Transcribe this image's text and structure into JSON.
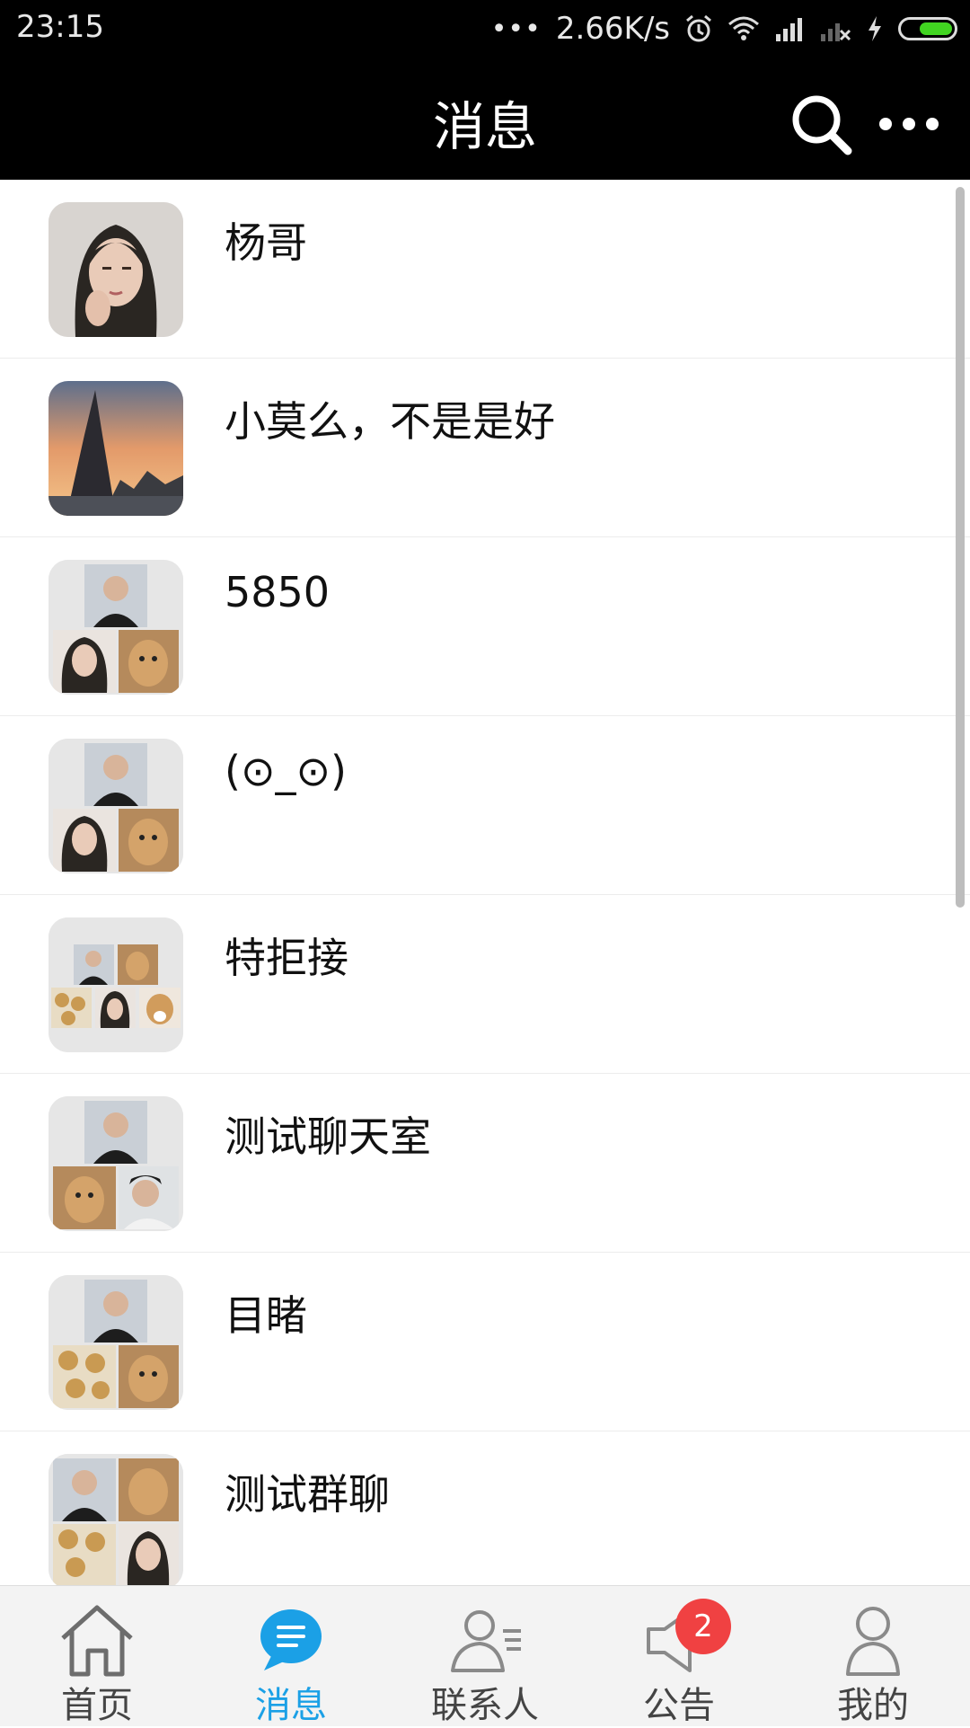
{
  "status_bar": {
    "time": "23:15",
    "net_speed": "2.66K/s",
    "dots": "•••",
    "icons": [
      "alarm-icon",
      "wifi-icon",
      "signal-icon",
      "signal-no-sim-icon",
      "charging-icon",
      "battery-icon"
    ]
  },
  "header": {
    "title": "消息",
    "icons": [
      "search-icon",
      "more-icon"
    ]
  },
  "conversations": [
    {
      "name": "杨哥"
    },
    {
      "name": "小莫么，不是是好"
    },
    {
      "name": "5850"
    },
    {
      "name": "(⊙_⊙)"
    },
    {
      "name": "特拒接"
    },
    {
      "name": "测试聊天室"
    },
    {
      "name": "目睹"
    },
    {
      "name": "测试群聊"
    }
  ],
  "tabs": [
    {
      "label": "首页",
      "icon": "home-icon"
    },
    {
      "label": "消息",
      "icon": "message-icon",
      "active": true
    },
    {
      "label": "联系人",
      "icon": "contacts-icon"
    },
    {
      "label": "公告",
      "icon": "announcement-icon",
      "badge": "2"
    },
    {
      "label": "我的",
      "icon": "profile-icon"
    }
  ],
  "colors": {
    "header_bg": "#000000",
    "active_tab": "#1ba0e6",
    "badge": "#f04142",
    "battery": "#41d421"
  }
}
